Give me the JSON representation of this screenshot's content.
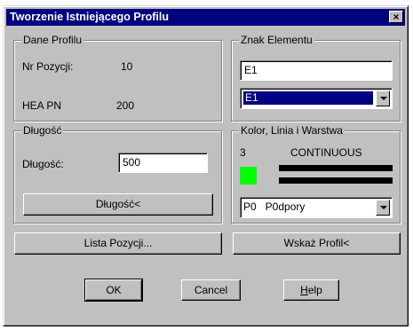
{
  "window": {
    "title": "Tworzenie Istniejącego Profilu",
    "close_glyph": "×"
  },
  "dane_profilu": {
    "legend": "Dane Profilu",
    "nr_pozycji_label": "Nr Pozycji:",
    "nr_pozycji_value": "10",
    "profile_type": "HEA PN",
    "profile_size": "200"
  },
  "znak_elementu": {
    "legend": "Znak Elementu",
    "input_value": "E1",
    "combo_value": "E1"
  },
  "dlugosc": {
    "legend": "Długość",
    "field_label": "Długość:",
    "field_value": "500",
    "button_label": "Długość<"
  },
  "kolor": {
    "legend": "Kolor, Linia i Warstwa",
    "color_number": "3",
    "color_hex": "#00ff00",
    "linetype": "CONTINUOUS",
    "layer_value": "P0   P0dpory"
  },
  "buttons": {
    "lista_pozycji": "Lista Pozycji...",
    "wskaz_profil": "Wskaż Profil<",
    "ok": "OK",
    "cancel": "Cancel",
    "help_underlined": "H",
    "help_rest": "elp"
  }
}
